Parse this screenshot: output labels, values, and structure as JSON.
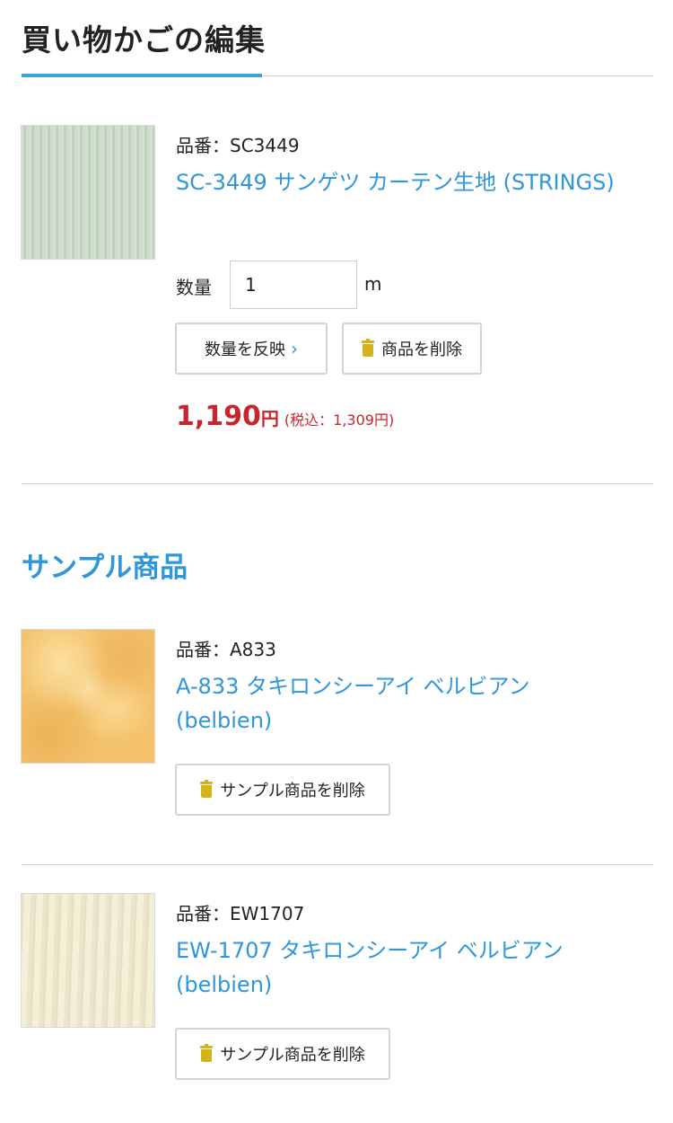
{
  "page": {
    "title": "買い物かごの編集"
  },
  "cart": {
    "item": {
      "code_text": "品番：SC3449",
      "name": "SC-3449 サンゲツ カーテン生地 (STRINGS)",
      "quantity_label": "数量",
      "quantity_value": "1",
      "quantity_unit": "m",
      "update_button_label": "数量を反映",
      "update_button_icon": "chevron-right-icon",
      "delete_button_label": "商品を削除",
      "delete_button_icon": "trash-icon",
      "price_amount": "1,190",
      "price_unit": "円",
      "price_tax_text": "(税込：1,309円)"
    }
  },
  "samples": {
    "section_title": "サンプル商品",
    "items": [
      {
        "code_text": "品番：A833",
        "name_line1": "A-833 タキロンシーアイ ベルビアン",
        "name_line2": "(belbien)",
        "delete_label": "サンプル商品を削除"
      },
      {
        "code_text": "品番：EW1707",
        "name_line1": "EW-1707 タキロンシーアイ ベルビアン",
        "name_line2": "(belbien)",
        "delete_label": "サンプル商品を削除"
      }
    ]
  },
  "colors": {
    "accent_blue": "#2e97d8",
    "price_red": "#c7262f",
    "trash_yellow": "#d2b31b"
  }
}
